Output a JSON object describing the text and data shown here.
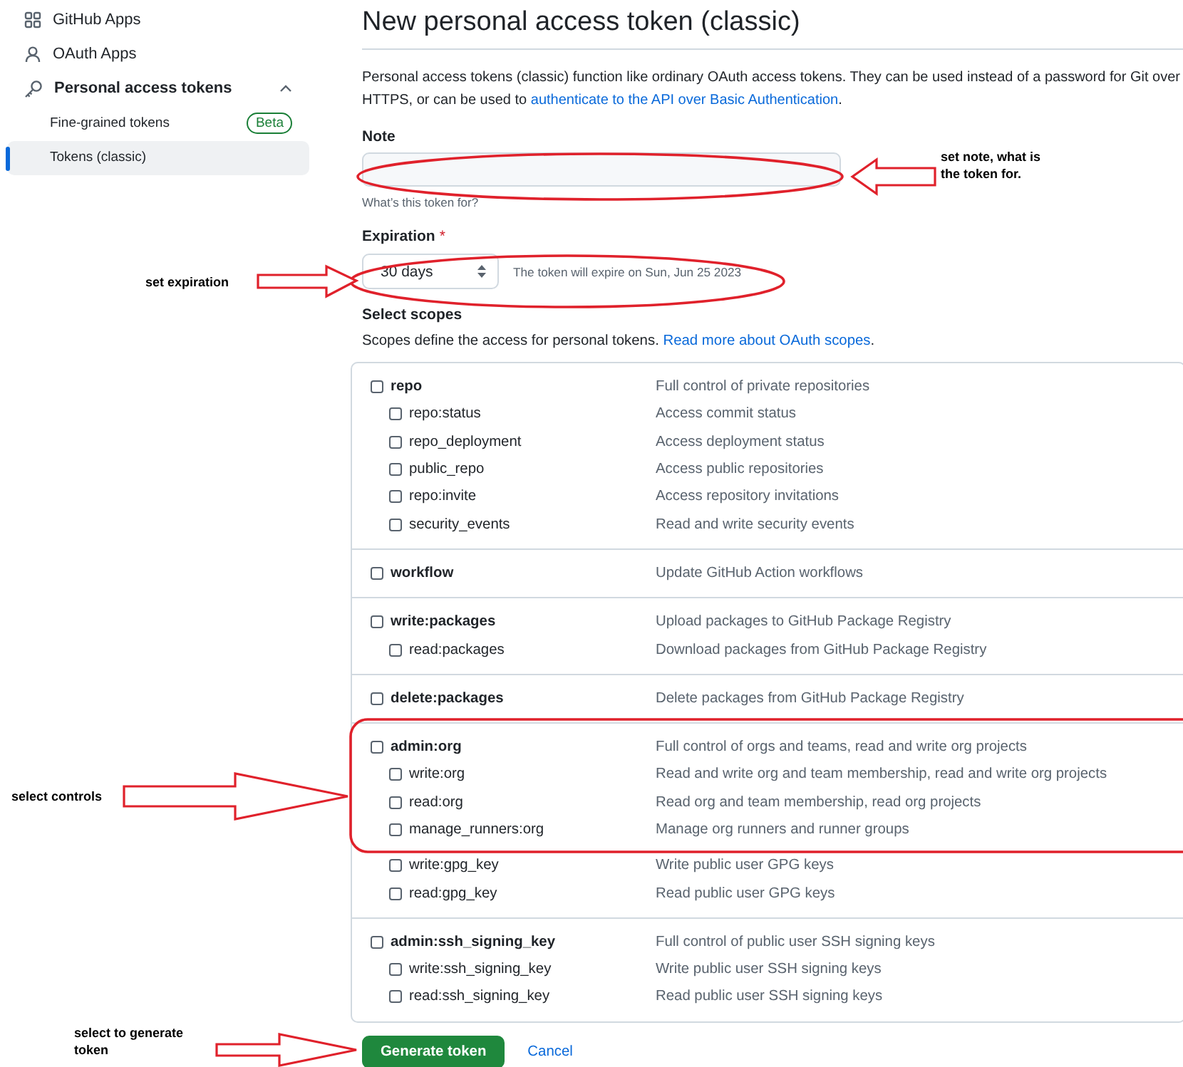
{
  "sidebar": {
    "items": [
      {
        "kind": "apps",
        "label": "GitHub Apps",
        "selected": false
      },
      {
        "kind": "person",
        "label": "OAuth Apps",
        "selected": false
      },
      {
        "kind": "key",
        "label": "Personal access tokens",
        "selected": false,
        "expanded": true,
        "children": [
          {
            "label": "Fine-grained tokens",
            "badge": "Beta",
            "selected": false
          },
          {
            "label": "Tokens (classic)",
            "selected": true
          }
        ]
      }
    ]
  },
  "main": {
    "title": "New personal access token (classic)",
    "intro": "Personal access tokens (classic) function like ordinary OAuth access tokens. They can be used instead of a password for Git over HTTPS, or can be used to ",
    "intro_link": "authenticate to the API over Basic Authentication",
    "intro_end": ".",
    "note": {
      "label": "Note",
      "hint": "What’s this token for?"
    },
    "expiration": {
      "label": "Expiration",
      "required_mark": "*",
      "value": "30 days",
      "info": "The token will expire on Sun, Jun 25 2023"
    },
    "scopes": {
      "label": "Select scopes",
      "description": "Scopes define the access for personal tokens. ",
      "link": "Read more about OAuth scopes",
      "end": "."
    },
    "scope_groups": [
      {
        "name": "repo",
        "description": "Full control of private repositories",
        "checked": false,
        "children": [
          {
            "name": "repo:status",
            "description": "Access commit status",
            "checked": false
          },
          {
            "name": "repo_deployment",
            "description": "Access deployment status",
            "checked": false
          },
          {
            "name": "public_repo",
            "description": "Access public repositories",
            "checked": false
          },
          {
            "name": "repo:invite",
            "description": "Access repository invitations",
            "checked": false
          },
          {
            "name": "security_events",
            "description": "Read and write security events",
            "checked": false
          }
        ]
      },
      {
        "name": "workflow",
        "description": "Update GitHub Action workflows",
        "checked": false
      },
      {
        "name": "write:packages",
        "description": "Upload packages to GitHub Package Registry",
        "checked": false,
        "children": [
          {
            "name": "read:packages",
            "description": "Download packages from GitHub Package Registry",
            "checked": false
          }
        ]
      },
      {
        "name": "delete:packages",
        "description": "Delete packages from GitHub Package Registry",
        "checked": false
      },
      {
        "name": "admin:org",
        "description": "Full control of orgs and teams, read and write org projects",
        "checked": false,
        "children": [
          {
            "name": "write:org",
            "description": "Read and write org and team membership, read and write org projects",
            "checked": false
          },
          {
            "name": "read:org",
            "description": "Read org and team membership, read org projects",
            "checked": false
          },
          {
            "name": "manage_runners:org",
            "description": "Manage org runners and runner groups",
            "checked": false
          },
          {
            "name": "write:gpg_key",
            "description": "Write public user GPG keys",
            "checked": false
          },
          {
            "name": "read:gpg_key",
            "description": "Read public user GPG keys",
            "checked": false
          }
        ]
      },
      {
        "name": "admin:ssh_signing_key",
        "description": "Full control of public user SSH signing keys",
        "checked": false,
        "children": [
          {
            "name": "write:ssh_signing_key",
            "description": "Write public user SSH signing keys",
            "checked": false
          },
          {
            "name": "read:ssh_signing_key",
            "description": "Read public user SSH signing keys",
            "checked": false
          }
        ]
      }
    ],
    "actions": {
      "primary": "Generate token",
      "secondary": "Cancel"
    }
  },
  "annotations": [
    {
      "text": "set note, what is the token for."
    },
    {
      "text": "set expiration"
    },
    {
      "text": "select controls"
    },
    {
      "text": "select to generate token"
    }
  ]
}
